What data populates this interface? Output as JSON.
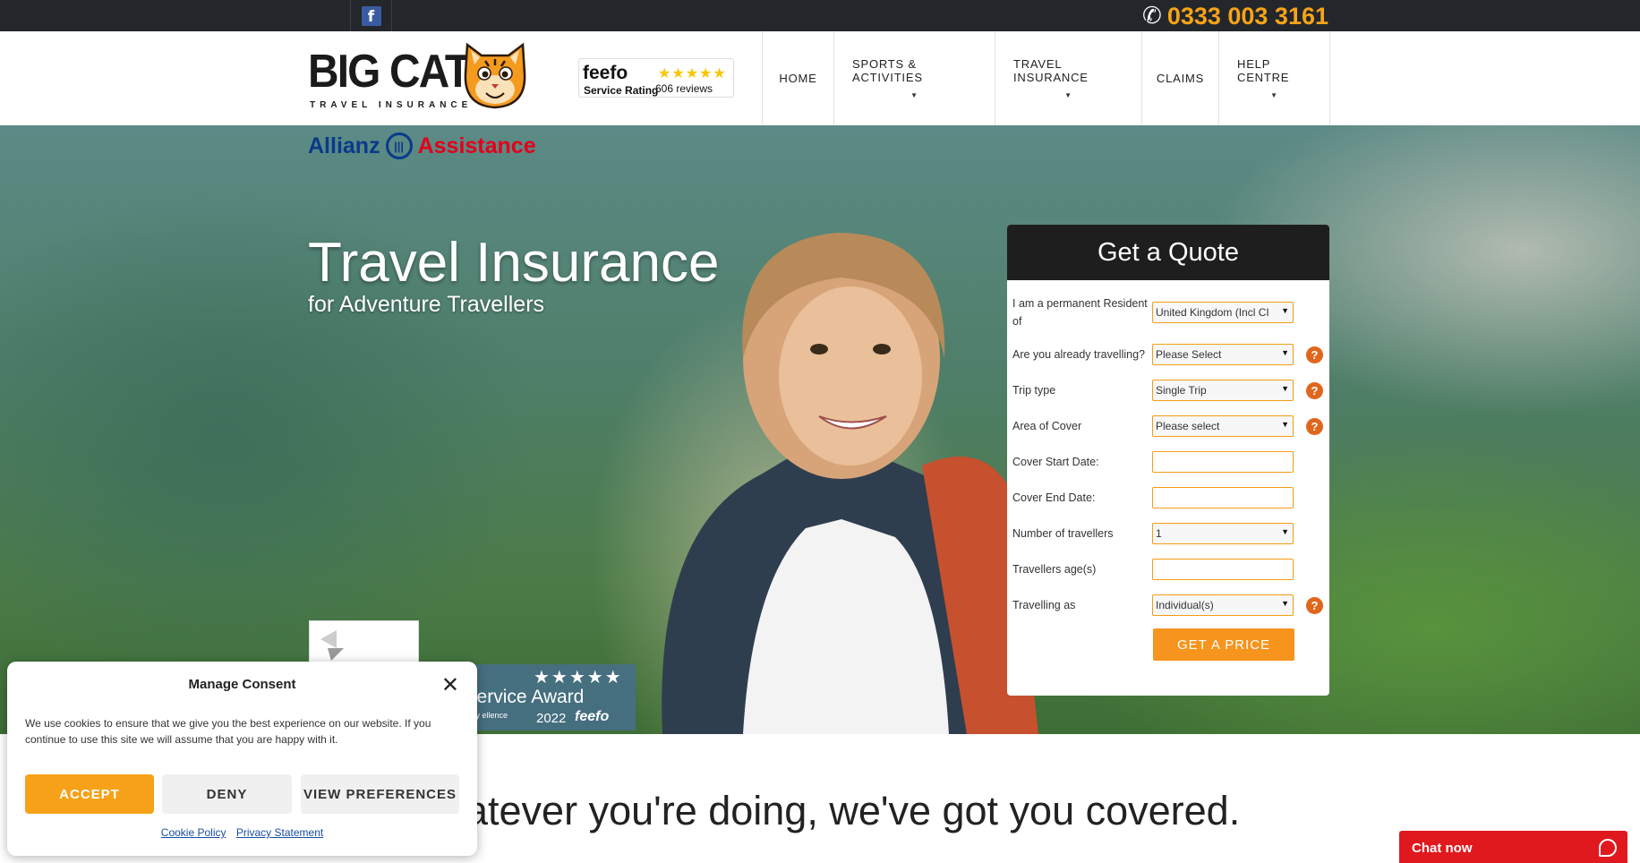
{
  "topbar": {
    "phone": "0333 003 3161"
  },
  "logo": {
    "main": "BIG CAT",
    "sub": "TRAVEL INSURANCE"
  },
  "feefo": {
    "brand": "feefo",
    "stars": "★★★★★",
    "rating_label": "Service Rating",
    "reviews": "606 reviews"
  },
  "nav": [
    {
      "label": "HOME",
      "has_dropdown": false
    },
    {
      "label": "SPORTS & ACTIVITIES",
      "has_dropdown": true
    },
    {
      "label": "TRAVEL INSURANCE",
      "has_dropdown": true
    },
    {
      "label": "CLAIMS",
      "has_dropdown": false
    },
    {
      "label": "HELP CENTRE",
      "has_dropdown": true
    }
  ],
  "allianz": {
    "name": "Allianz",
    "assistance": "Assistance"
  },
  "hero": {
    "title": "Travel Insurance",
    "subtitle": "for Adventure Travellers"
  },
  "award": {
    "stars": "★★★★★",
    "title": "um    d Service Award",
    "line": "ntly ellence",
    "year": "2022",
    "brand": "feefo"
  },
  "quote": {
    "title": "Get a Quote",
    "fields": [
      {
        "label": "I am a permanent Resident of",
        "value": "United Kingdom (Incl CI",
        "type": "select",
        "help": false
      },
      {
        "label": "Are you already travelling?",
        "value": "Please Select",
        "type": "select",
        "help": true
      },
      {
        "label": "Trip type",
        "value": "Single Trip",
        "type": "select",
        "help": true
      },
      {
        "label": "Area of Cover",
        "value": "Please select",
        "type": "select",
        "help": true
      },
      {
        "label": "Cover Start Date:",
        "value": "",
        "type": "input",
        "help": false
      },
      {
        "label": "Cover End Date:",
        "value": "",
        "type": "input",
        "help": false
      },
      {
        "label": "Number of travellers",
        "value": "1",
        "type": "select",
        "help": false
      },
      {
        "label": "Travellers age(s)",
        "value": "",
        "type": "input",
        "help": false
      },
      {
        "label": "Travelling as",
        "value": "Individual(s)",
        "type": "select",
        "help": true
      }
    ],
    "submit": "GET A PRICE"
  },
  "tagline": "atever you're doing, we've got you covered.",
  "consent": {
    "title": "Manage Consent",
    "text": "We use cookies to ensure that we give you the best experience on our website. If you continue to use this site we will assume that you are happy with it.",
    "accept": "ACCEPT",
    "deny": "DENY",
    "preferences": "VIEW PREFERENCES",
    "cookie_policy": "Cookie Policy",
    "privacy": "Privacy Statement"
  },
  "chat": {
    "label": "Chat now"
  },
  "colors": {
    "accent": "#f7941d",
    "dark": "#23272b",
    "allianz_blue": "#0a3a8c",
    "allianz_red": "#e3001b",
    "chat_red": "#e0191e"
  }
}
